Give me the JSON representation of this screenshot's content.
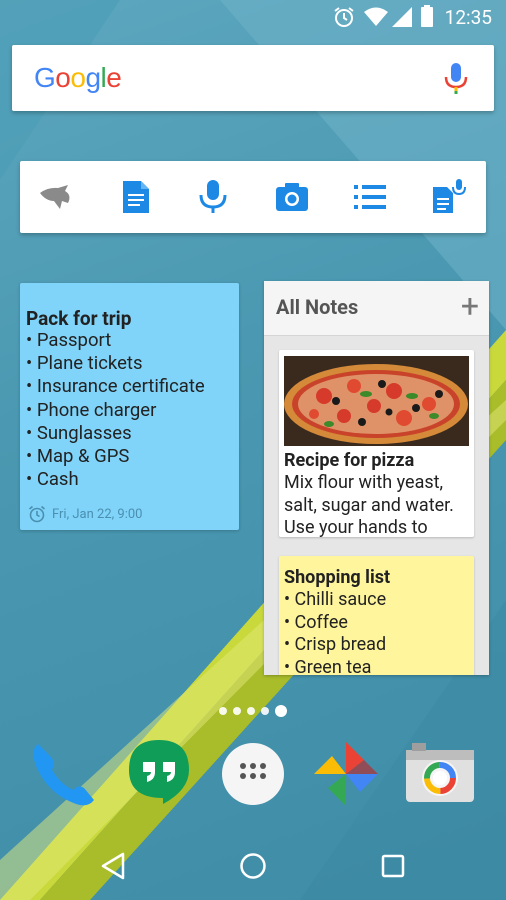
{
  "status_bar": {
    "time": "12:35"
  },
  "search_widget": {
    "logo": "Google"
  },
  "quick_actions": [
    {
      "name": "eagle-icon"
    },
    {
      "name": "text-note-icon"
    },
    {
      "name": "voice-note-icon"
    },
    {
      "name": "camera-note-icon"
    },
    {
      "name": "list-note-icon"
    },
    {
      "name": "audio-note-icon"
    }
  ],
  "note_widget": {
    "title": "Pack for trip",
    "items": [
      "• Passport",
      "• Plane tickets",
      "• Insurance certificate",
      "• Phone charger",
      "• Sunglasses",
      "• Map & GPS",
      "• Cash"
    ],
    "reminder": "Fri, Jan 22, 9:00",
    "color": "#80d4f9"
  },
  "all_notes": {
    "title": "All Notes",
    "add_label": "+",
    "cards": [
      {
        "title": "Recipe for pizza",
        "body": [
          "Mix flour with yeast,",
          "salt, sugar and water.",
          "Use your hands to"
        ]
      },
      {
        "title": "Shopping list",
        "body": [
          "• Chilli sauce",
          "• Coffee",
          "• Crisp bread",
          "• Green tea"
        ]
      }
    ]
  },
  "dock": [
    "phone-icon",
    "hangouts-icon",
    "app-drawer-icon",
    "photos-icon",
    "camera-icon"
  ],
  "colors": {
    "accent": "#1e88e5",
    "wallpaper": "#4a98b1",
    "note_yellow": "#fff59d"
  }
}
